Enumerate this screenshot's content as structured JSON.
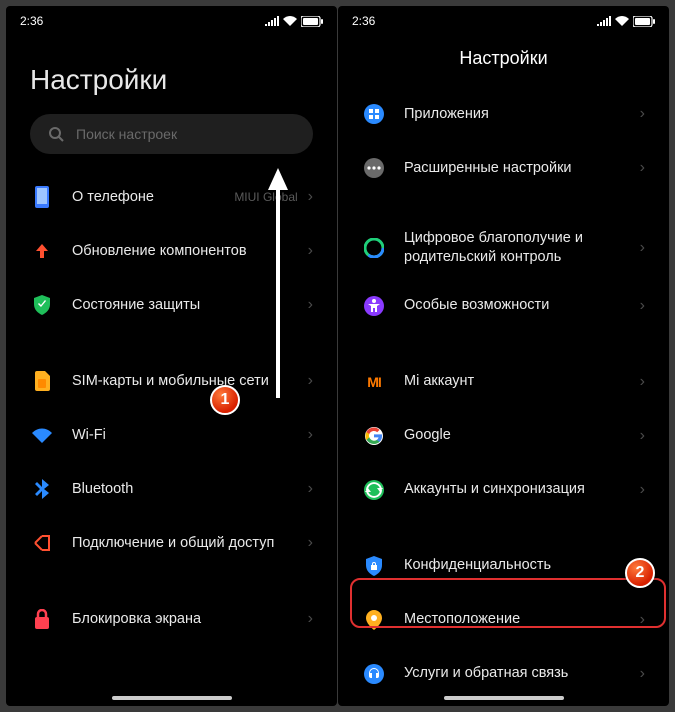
{
  "status": {
    "time": "2:36"
  },
  "left": {
    "title": "Настройки",
    "search_placeholder": "Поиск настроек",
    "items": [
      {
        "label": "О телефоне",
        "sub": "MIUI Global"
      },
      {
        "label": "Обновление компонентов"
      },
      {
        "label": "Состояние защиты"
      }
    ],
    "items2": [
      {
        "label": "SIM-карты и мобильные сети"
      },
      {
        "label": "Wi-Fi"
      },
      {
        "label": "Bluetooth"
      },
      {
        "label": "Подключение и общий доступ"
      }
    ],
    "items3": [
      {
        "label": "Блокировка экрана"
      }
    ]
  },
  "right": {
    "title": "Настройки",
    "items": [
      {
        "label": "Приложения"
      },
      {
        "label": "Расширенные настройки"
      }
    ],
    "items2": [
      {
        "label": "Цифровое благополучие и родительский контроль"
      },
      {
        "label": "Особые возможности"
      }
    ],
    "items3": [
      {
        "label": "Mi аккаунт"
      },
      {
        "label": "Google"
      },
      {
        "label": "Аккаунты и синхронизация"
      }
    ],
    "items4": [
      {
        "label": "Конфиденциальность"
      },
      {
        "label": "Местоположение"
      },
      {
        "label": "Услуги и обратная связь"
      }
    ]
  },
  "steps": {
    "one": "1",
    "two": "2"
  }
}
